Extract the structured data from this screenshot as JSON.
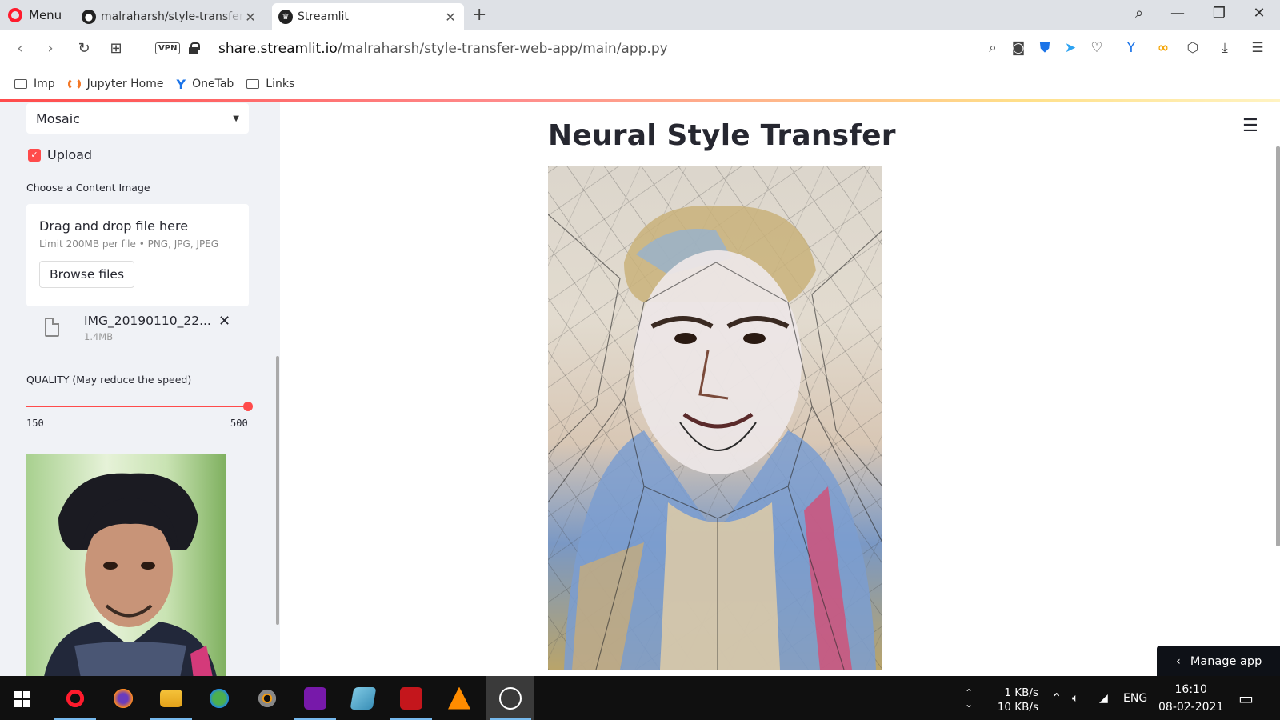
{
  "browser": {
    "menu_label": "Menu",
    "tabs": [
      {
        "title": "malraharsh/style-transfer-web-app",
        "active": false
      },
      {
        "title": "Streamlit",
        "active": true
      }
    ],
    "url_domain": "share.streamlit.io",
    "url_path": "/malraharsh/style-transfer-web-app/main/app.py",
    "vpn_label": "VPN",
    "bookmarks": [
      "Imp",
      "Jupyter Home",
      "OneTab",
      "Links"
    ]
  },
  "sidebar": {
    "style_select_value": "Mosaic",
    "upload_checkbox_label": "Upload",
    "upload_checked": true,
    "uploader_label": "Choose a Content Image",
    "dropzone_title": "Drag and drop file here",
    "dropzone_limit": "Limit 200MB per file • PNG, JPG, JPEG",
    "browse_button": "Browse files",
    "file_name": "IMG_20190110_22...",
    "file_size": "1.4MB",
    "quality_label": "QUALITY (May reduce the speed)",
    "slider_min": "150",
    "slider_max": "500",
    "slider_value_fraction": 1.0
  },
  "main": {
    "title": "Neural Style Transfer",
    "manage_app_label": "Manage app"
  },
  "taskbar": {
    "net_up": "1 KB/s",
    "net_down": "10 KB/s",
    "language": "ENG",
    "time": "16:10",
    "date": "08-02-2021"
  },
  "colors": {
    "accent": "#ff4b4b",
    "sidebar_bg": "#f0f2f6",
    "text": "#262730"
  }
}
